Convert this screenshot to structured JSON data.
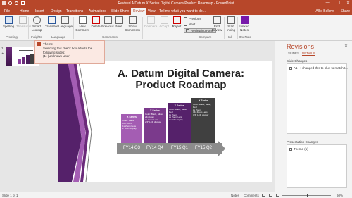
{
  "window": {
    "title": "Revised A.Datum X Series Digital Camera Product Roadmap - PowerPoint",
    "controls": [
      "—",
      "☐",
      "✕"
    ]
  },
  "tabs": {
    "items": [
      "File",
      "Home",
      "Insert",
      "Design",
      "Transitions",
      "Animations",
      "Slide Show",
      "Review",
      "View"
    ],
    "active": "Review",
    "tellme": "Tell me what you want to do...",
    "user": "Allie Bellew",
    "share": "Share"
  },
  "ribbon": {
    "spelling": "Spelling",
    "thesaurus": "Thesaurus",
    "smart_lookup": "Smart Lookup",
    "translate": "Translate",
    "language": "Language",
    "new_comment": "New Comment",
    "delete": "Delete",
    "previous": "Previous",
    "next": "Next",
    "show_comments": "Show Comments",
    "compare": "Compare",
    "accept": "Accept",
    "reject": "Reject",
    "prev_small": "Previous",
    "next_small": "Next",
    "reviewing_pane": "Reviewing Pane",
    "end_review": "End Review",
    "start_inking": "Start Inking",
    "linked_notes": "Linked Notes",
    "groups": {
      "proofing": "Proofing",
      "insights": "Insights",
      "language": "Language",
      "comments": "Comments",
      "compare": "Compare",
      "ink": "Ink",
      "onenote": "OneNote"
    }
  },
  "thumbnails": {
    "number": "1",
    "star": "★"
  },
  "tooltip": {
    "title": "Theme",
    "line1": "Selecting this check box affects the",
    "line2": "following slides:",
    "line3": "(1) (Unknown User)"
  },
  "slide": {
    "title_line1": "A. Datum Digital Camera:",
    "title_line2": "Product Roadmap",
    "bars": [
      {
        "title": "X Series",
        "lines": [
          "Color: Black",
          "10x Zoom",
          "1x Zoom Lens",
          "2\" LCD display"
        ]
      },
      {
        "title": "X Series",
        "lines": [
          "Color: Black, Silver",
          "24x zoom",
          "2x Zoom Lens",
          "2.5\" LCD display"
        ]
      },
      {
        "title": "X Series",
        "lines": [
          "Color: Black, Silver, Red",
          "Lx Zoom",
          "2x Zoom Lens",
          "3\" LCD display"
        ]
      },
      {
        "title": "X Series",
        "lines": [
          "Color: Black, Silver, Red",
          "Lx Zoom",
          "34x Zoom Lens",
          "3.5\" LCD display"
        ]
      }
    ],
    "quarters": [
      "FY14 Q3",
      "FY14 Q4",
      "FY15 Q1",
      "FY15 Q2"
    ]
  },
  "revisions": {
    "title": "Revisions",
    "close": "✕",
    "tabs": [
      "SLIDES",
      "DETAILS"
    ],
    "active_tab": "DETAILS",
    "slide_changes_label": "Slide Changes",
    "slide_change_item": "A1 - I changed this to blue to match t...",
    "presentation_changes_label": "Presentation Changes",
    "presentation_change_item": "Theme (1)"
  },
  "statusbar": {
    "slide": "Slide 1 of 1",
    "notes": "Notes",
    "comments": "Comments",
    "zoom": "60%"
  },
  "colors": {
    "accent": "#b7472a",
    "bar1": "#a45db3",
    "bar2": "#7b3a8c",
    "bar3": "#55216a",
    "bar4": "#404040"
  }
}
